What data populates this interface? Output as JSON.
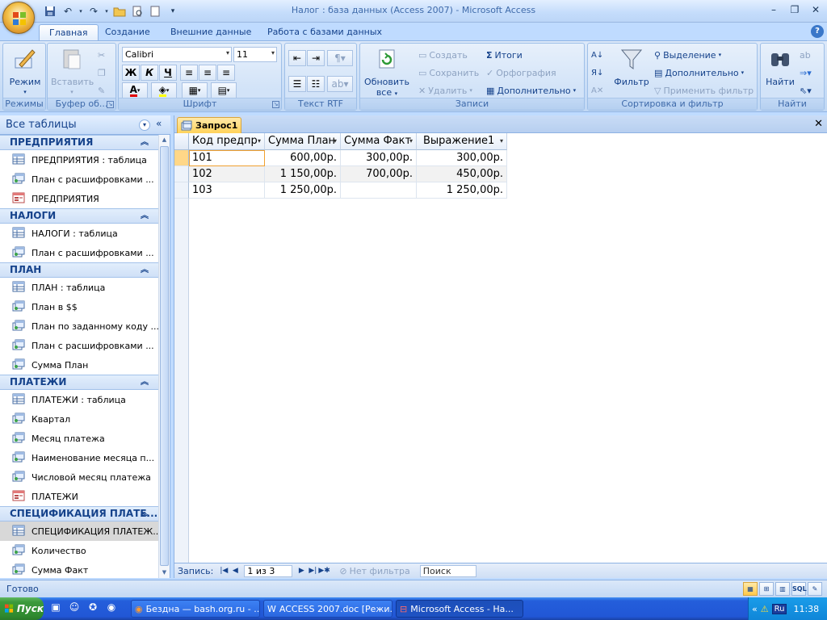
{
  "window": {
    "title": "Налог : база данных (Access 2007) - Microsoft Access"
  },
  "ribbon_tabs": [
    "Главная",
    "Создание",
    "Внешние данные",
    "Работа с базами данных"
  ],
  "ribbon": {
    "groups": {
      "views": "Режимы",
      "clipboard": "Буфер об...",
      "font": "Шрифт",
      "rtf": "Текст RTF",
      "records": "Записи",
      "sortfilter": "Сортировка и фильтр",
      "find": "Найти"
    },
    "view_btn": "Режим",
    "paste_btn": "Вставить",
    "font_name": "Calibri",
    "font_size": "11",
    "bold": "Ж",
    "italic": "К",
    "underline": "Ч",
    "refresh_btn": [
      "Обновить",
      "все"
    ],
    "records": {
      "new": "Создать",
      "save": "Сохранить",
      "delete": "Удалить",
      "totals": "Итоги",
      "spelling": "Орфография",
      "more": "Дополнительно"
    },
    "filter_btn": "Фильтр",
    "sort": {
      "selection": "Выделение",
      "advanced": "Дополнительно",
      "apply": "Применить фильтр"
    },
    "find_btn": "Найти"
  },
  "nav": {
    "title": "Все таблицы",
    "groups": [
      {
        "name": "ПРЕДПРИЯТИЯ",
        "items": [
          {
            "label": "ПРЕДПРИЯТИЯ : таблица",
            "type": "table"
          },
          {
            "label": "План с расшифровками ...",
            "type": "query"
          },
          {
            "label": "ПРЕДПРИЯТИЯ",
            "type": "form"
          }
        ]
      },
      {
        "name": "НАЛОГИ",
        "items": [
          {
            "label": "НАЛОГИ : таблица",
            "type": "table"
          },
          {
            "label": "План с расшифровками ...",
            "type": "query"
          }
        ]
      },
      {
        "name": "ПЛАН",
        "items": [
          {
            "label": "ПЛАН : таблица",
            "type": "table"
          },
          {
            "label": "План в $$",
            "type": "query"
          },
          {
            "label": "План по заданному коду ...",
            "type": "query"
          },
          {
            "label": "План с расшифровками ...",
            "type": "query"
          },
          {
            "label": "Сумма План",
            "type": "query"
          }
        ]
      },
      {
        "name": "ПЛАТЕЖИ",
        "items": [
          {
            "label": "ПЛАТЕЖИ : таблица",
            "type": "table"
          },
          {
            "label": "Квартал",
            "type": "query"
          },
          {
            "label": "Месяц платежа",
            "type": "query"
          },
          {
            "label": "Наименование месяца п...",
            "type": "query"
          },
          {
            "label": "Числовой месяц платежа",
            "type": "query"
          },
          {
            "label": "ПЛАТЕЖИ",
            "type": "form"
          }
        ]
      },
      {
        "name": "СПЕЦИФИКАЦИЯ ПЛАТЕ...",
        "items": [
          {
            "label": "СПЕЦИФИКАЦИЯ ПЛАТЕЖ...",
            "type": "table",
            "selected": true
          },
          {
            "label": "Количество",
            "type": "query"
          },
          {
            "label": "Сумма Факт",
            "type": "query"
          }
        ]
      }
    ]
  },
  "doc_tab": "Запрос1",
  "grid": {
    "columns": [
      "Код предпр",
      "Сумма План",
      "Сумма Факт",
      "Выражение1"
    ],
    "rows": [
      [
        "101",
        "600,00р.",
        "300,00р.",
        "300,00р."
      ],
      [
        "102",
        "1 150,00р.",
        "700,00р.",
        "450,00р."
      ],
      [
        "103",
        "1 250,00р.",
        "",
        "1 250,00р."
      ]
    ]
  },
  "record_nav": {
    "label": "Запись:",
    "position": "1 из 3",
    "no_filter": "Нет фильтра",
    "search": "Поиск"
  },
  "status": {
    "text": "Готово",
    "sql": "SQL"
  },
  "taskbar": {
    "start": "Пуск",
    "tasks": [
      "Бездна — bash.org.ru - ...",
      "ACCESS 2007.doc [Режи...",
      "Microsoft Access - На..."
    ],
    "lang": "Ru",
    "time": "11:38"
  }
}
